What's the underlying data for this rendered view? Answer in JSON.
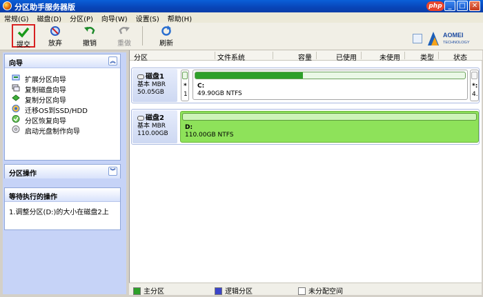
{
  "window": {
    "title": "分区助手服务器版",
    "badge": "php"
  },
  "menu": [
    "常规(G)",
    "磁盘(D)",
    "分区(P)",
    "向导(W)",
    "设置(S)",
    "帮助(H)"
  ],
  "toolbar": {
    "commit": "提交",
    "discard": "放弃",
    "undo": "撤销",
    "redo": "重做",
    "refresh": "刷新",
    "brand_line1": "AOMEI",
    "brand_line2": "TECHNOLOGY"
  },
  "wizard": {
    "title": "向导",
    "items": [
      {
        "label": "扩展分区向导",
        "icon": "extend-partition-icon"
      },
      {
        "label": "复制磁盘向导",
        "icon": "copy-disk-icon"
      },
      {
        "label": "复制分区向导",
        "icon": "copy-partition-icon"
      },
      {
        "label": "迁移OS到SSD/HDD",
        "icon": "migrate-os-icon"
      },
      {
        "label": "分区恢复向导",
        "icon": "partition-recovery-icon"
      },
      {
        "label": "启动光盘制作向导",
        "icon": "bootable-cd-icon"
      }
    ]
  },
  "partition_ops": {
    "title": "分区操作"
  },
  "pending": {
    "title": "等待执行的操作",
    "items": [
      "1.调整分区(D:)的大小在磁盘2上"
    ]
  },
  "columns": [
    "分区",
    "文件系统",
    "容量",
    "已使用",
    "未使用",
    "类型",
    "状态"
  ],
  "disks": [
    {
      "name": "磁盘1",
      "type": "基本 MBR",
      "size": "50.05GB",
      "small_part_label": "*",
      "small_part_num": "1",
      "partition": {
        "name": "C:",
        "info": "49.90GB NTFS",
        "used_fraction": 0.4
      },
      "tail_labels": [
        "*:",
        "4."
      ]
    },
    {
      "name": "磁盘2",
      "type": "基本 MBR",
      "size": "110.00GB",
      "partition": {
        "name": "D:",
        "info": "110.00GB NTFS",
        "used_fraction": 0.0
      }
    }
  ],
  "legend": [
    {
      "label": "主分区",
      "color": "#2ea02a"
    },
    {
      "label": "逻辑分区",
      "color": "#3b45c9"
    },
    {
      "label": "未分配空间",
      "color": "#ffffff"
    }
  ]
}
